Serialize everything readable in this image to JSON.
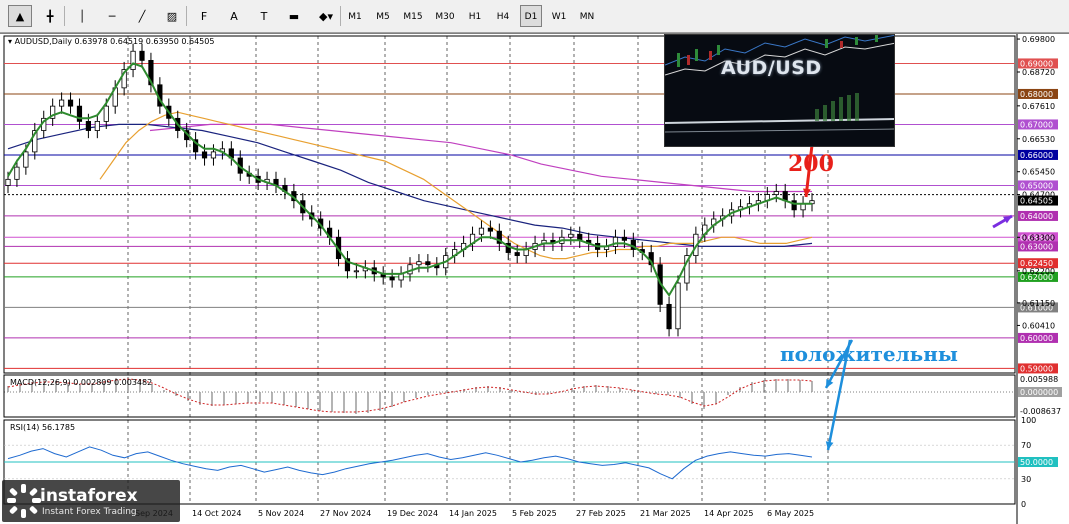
{
  "toolbar": {
    "tools": [
      {
        "icon": "cursor-icon",
        "glyph": "▲",
        "active": true
      },
      {
        "icon": "crosshair-icon",
        "glyph": "╋",
        "active": false
      },
      {
        "icon": "vertical-line-icon",
        "glyph": "│",
        "active": false
      },
      {
        "icon": "horizontal-line-icon",
        "glyph": "─",
        "active": false
      },
      {
        "icon": "trendline-icon",
        "glyph": "╱",
        "active": false
      },
      {
        "icon": "channel-icon",
        "glyph": "▨",
        "active": false
      },
      {
        "icon": "fibonacci-icon",
        "glyph": "F",
        "active": false
      },
      {
        "icon": "text-icon",
        "glyph": "A",
        "active": false
      },
      {
        "icon": "text-label-icon",
        "glyph": "T",
        "active": false
      },
      {
        "icon": "rectangle-icon",
        "glyph": "▬",
        "active": false
      },
      {
        "icon": "arrows-icon",
        "glyph": "◆▾",
        "active": false
      }
    ],
    "timeframes": [
      {
        "label": "M1",
        "active": false
      },
      {
        "label": "M5",
        "active": false
      },
      {
        "label": "M15",
        "active": false
      },
      {
        "label": "M30",
        "active": false
      },
      {
        "label": "H1",
        "active": false
      },
      {
        "label": "H4",
        "active": false
      },
      {
        "label": "D1",
        "active": true
      },
      {
        "label": "W1",
        "active": false
      },
      {
        "label": "MN",
        "active": false
      }
    ]
  },
  "chart_data": {
    "type": "line",
    "symbol_header": "AUDUSD,Daily",
    "ohlc_header": "0.63978 0.64519 0.63950 0.64505",
    "current_price": "0.64505",
    "price_axis_ticks": [
      "0.69800",
      "0.68720",
      "0.67610",
      "0.66530",
      "0.65450",
      "0.64700",
      "0.63300",
      "0.62200",
      "0.61150",
      "0.60410"
    ],
    "ylim": [
      0.5885,
      0.699
    ],
    "price_levels": [
      {
        "price": 0.69,
        "label": "0.69000",
        "color": "#e05050"
      },
      {
        "price": 0.68,
        "label": "0.68000",
        "color": "#8b4513"
      },
      {
        "price": 0.67,
        "label": "0.67000",
        "color": "#b050d0"
      },
      {
        "price": 0.66,
        "label": "0.66000",
        "color": "#0000a0"
      },
      {
        "price": 0.65,
        "label": "0.65000",
        "color": "#b050d0"
      },
      {
        "price": 0.64,
        "label": "0.64000",
        "color": "#b030b0"
      },
      {
        "price": 0.633,
        "label": "0.63300",
        "color": "#d050d0"
      },
      {
        "price": 0.63,
        "label": "0.63000",
        "color": "#b030b0"
      },
      {
        "price": 0.6245,
        "label": "0.62450",
        "color": "#e03030"
      },
      {
        "price": 0.62,
        "label": "0.62000",
        "color": "#20a020"
      },
      {
        "price": 0.61,
        "label": "0.61000",
        "color": "#808080"
      },
      {
        "price": 0.6,
        "label": "0.60000",
        "color": "#b030b0"
      },
      {
        "price": 0.59,
        "label": "0.59000",
        "color": "#e03030"
      }
    ],
    "dotted_level": 0.647,
    "x_tick_labels": [
      "Sep 2024",
      "14 Oct 2024",
      "5 Nov 2024",
      "27 Nov 2024",
      "19 Dec 2024",
      "14 Jan 2025",
      "5 Feb 2025",
      "27 Feb 2025",
      "21 Mar 2025",
      "14 Apr 2025",
      "6 May 2025"
    ],
    "price_close_series": [
      0.652,
      0.656,
      0.661,
      0.668,
      0.672,
      0.676,
      0.678,
      0.676,
      0.671,
      0.668,
      0.671,
      0.676,
      0.682,
      0.688,
      0.694,
      0.691,
      0.683,
      0.676,
      0.672,
      0.668,
      0.665,
      0.661,
      0.659,
      0.661,
      0.662,
      0.659,
      0.654,
      0.653,
      0.651,
      0.652,
      0.65,
      0.648,
      0.645,
      0.641,
      0.639,
      0.636,
      0.633,
      0.626,
      0.622,
      0.622,
      0.623,
      0.621,
      0.62,
      0.619,
      0.621,
      0.624,
      0.625,
      0.624,
      0.623,
      0.627,
      0.629,
      0.631,
      0.634,
      0.636,
      0.635,
      0.631,
      0.628,
      0.627,
      0.629,
      0.631,
      0.632,
      0.631,
      0.633,
      0.634,
      0.632,
      0.631,
      0.629,
      0.63,
      0.633,
      0.632,
      0.629,
      0.628,
      0.624,
      0.611,
      0.603,
      0.618,
      0.627,
      0.634,
      0.637,
      0.639,
      0.64,
      0.642,
      0.643,
      0.644,
      0.645,
      0.647,
      0.648,
      0.645,
      0.642,
      0.644,
      0.645
    ],
    "ema_fast_series": [
      0.653,
      0.658,
      0.662,
      0.667,
      0.671,
      0.673,
      0.674,
      0.673,
      0.672,
      0.672,
      0.673,
      0.677,
      0.682,
      0.687,
      0.69,
      0.689,
      0.684,
      0.678,
      0.674,
      0.67,
      0.667,
      0.664,
      0.662,
      0.662,
      0.661,
      0.659,
      0.656,
      0.654,
      0.652,
      0.651,
      0.65,
      0.648,
      0.646,
      0.643,
      0.64,
      0.637,
      0.633,
      0.629,
      0.625,
      0.624,
      0.623,
      0.622,
      0.621,
      0.621,
      0.621,
      0.622,
      0.623,
      0.623,
      0.624,
      0.625,
      0.627,
      0.629,
      0.631,
      0.633,
      0.633,
      0.632,
      0.63,
      0.629,
      0.629,
      0.63,
      0.631,
      0.631,
      0.632,
      0.632,
      0.632,
      0.631,
      0.63,
      0.63,
      0.631,
      0.631,
      0.63,
      0.628,
      0.625,
      0.618,
      0.614,
      0.619,
      0.625,
      0.63,
      0.634,
      0.637,
      0.639,
      0.641,
      0.642,
      0.643,
      0.644,
      0.645,
      0.646,
      0.645,
      0.644,
      0.644,
      0.644
    ],
    "ma_mid_series": [
      0.652,
      0.658,
      0.664,
      0.668,
      0.671,
      0.673,
      0.674,
      0.673,
      0.672,
      0.671,
      0.67,
      0.669,
      0.668,
      0.667,
      0.666,
      0.665,
      0.664,
      0.663,
      0.662,
      0.661,
      0.66,
      0.659,
      0.658,
      0.656,
      0.654,
      0.652,
      0.649,
      0.646,
      0.643,
      0.64,
      0.637,
      0.634,
      0.631,
      0.629,
      0.627,
      0.626,
      0.626,
      0.627,
      0.628,
      0.628,
      0.629,
      0.629,
      0.63,
      0.63,
      0.631,
      0.631,
      0.631,
      0.632,
      0.633,
      0.633,
      0.632,
      0.631,
      0.631,
      0.631,
      0.632,
      0.633
    ],
    "ma_slow_series": [
      0.662,
      0.665,
      0.667,
      0.669,
      0.67,
      0.67,
      0.669,
      0.668,
      0.666,
      0.664,
      0.661,
      0.658,
      0.655,
      0.651,
      0.648,
      0.645,
      0.643,
      0.641,
      0.639,
      0.637,
      0.636,
      0.634,
      0.633,
      0.632,
      0.631,
      0.63,
      0.63,
      0.63,
      0.63,
      0.631
    ],
    "ma_long_series": [
      0.668,
      0.669,
      0.67,
      0.67,
      0.67,
      0.669,
      0.668,
      0.667,
      0.666,
      0.665,
      0.664,
      0.662,
      0.66,
      0.657,
      0.655,
      0.653,
      0.652,
      0.651,
      0.65,
      0.649,
      0.648,
      0.648,
      0.648
    ],
    "macd": {
      "label": "MACD(12,26,9) 0.002809 0.003482",
      "ticks": [
        "0.005988",
        "0.000000",
        "-0.008637"
      ],
      "histogram": [
        0.6,
        0.8,
        1,
        1.2,
        1.1,
        0.9,
        0.7,
        0.8,
        1.1,
        1.4,
        1.5,
        1.3,
        0.8,
        0.2,
        -0.4,
        -0.9,
        -1.3,
        -1.4,
        -1.3,
        -1.2,
        -1.1,
        -1,
        -1.1,
        -1.3,
        -1.5,
        -1.7,
        -1.9,
        -2,
        -2.1,
        -2.2,
        -2.1,
        -1.9,
        -1.5,
        -1,
        -0.6,
        -0.3,
        -0.1,
        0.1,
        0.3,
        0.5,
        0.6,
        0.5,
        0.2,
        -0.1,
        -0.3,
        -0.2,
        0.1,
        0.4,
        0.6,
        0.7,
        0.6,
        0.4,
        0.2,
        0,
        -0.2,
        -0.3,
        -0.6,
        -1.2,
        -1.7,
        -1.2,
        -0.3,
        0.5,
        1,
        1.2,
        1.3,
        1.3,
        1.2,
        1.1
      ],
      "signal": [
        0.5,
        0.7,
        0.9,
        1,
        1,
        0.9,
        0.8,
        0.8,
        1,
        1.2,
        1.3,
        1.2,
        0.9,
        0.4,
        -0.2,
        -0.7,
        -1.1,
        -1.3,
        -1.3,
        -1.2,
        -1.1,
        -1.1,
        -1.1,
        -1.3,
        -1.5,
        -1.7,
        -1.9,
        -2,
        -2,
        -2,
        -1.9,
        -1.7,
        -1.4,
        -1,
        -0.7,
        -0.4,
        -0.2,
        0,
        0.2,
        0.4,
        0.5,
        0.4,
        0.2,
        0,
        -0.2,
        -0.2,
        0,
        0.3,
        0.5,
        0.6,
        0.5,
        0.4,
        0.2,
        0,
        -0.2,
        -0.3,
        -0.5,
        -1,
        -1.4,
        -1.2,
        -0.5,
        0.3,
        0.8,
        1.1,
        1.2,
        1.2,
        1.2,
        1.1
      ],
      "range": [
        -2.5,
        1.7
      ]
    },
    "rsi": {
      "label": "RSI(14) 56.1785",
      "ticks": [
        "100",
        "70",
        "50",
        "30",
        "0"
      ],
      "level": "50.0000",
      "values": [
        54,
        58,
        63,
        66,
        60,
        56,
        62,
        68,
        64,
        58,
        55,
        60,
        62,
        57,
        52,
        48,
        45,
        42,
        40,
        44,
        46,
        42,
        38,
        41,
        44,
        40,
        37,
        35,
        38,
        42,
        45,
        48,
        50,
        52,
        55,
        58,
        60,
        56,
        53,
        55,
        58,
        61,
        58,
        54,
        50,
        52,
        55,
        57,
        54,
        50,
        48,
        46,
        47,
        49,
        46,
        43,
        36,
        30,
        42,
        52,
        57,
        60,
        62,
        60,
        58,
        57,
        59,
        60,
        58,
        56
      ],
      "range": [
        0,
        100
      ]
    }
  },
  "overlay": {
    "hero_title": "AUD/USD",
    "annotation_200": "200",
    "annotation_positive": "положительны"
  },
  "watermark": {
    "brand": "instaforex",
    "tagline": "Instant Forex Trading"
  }
}
